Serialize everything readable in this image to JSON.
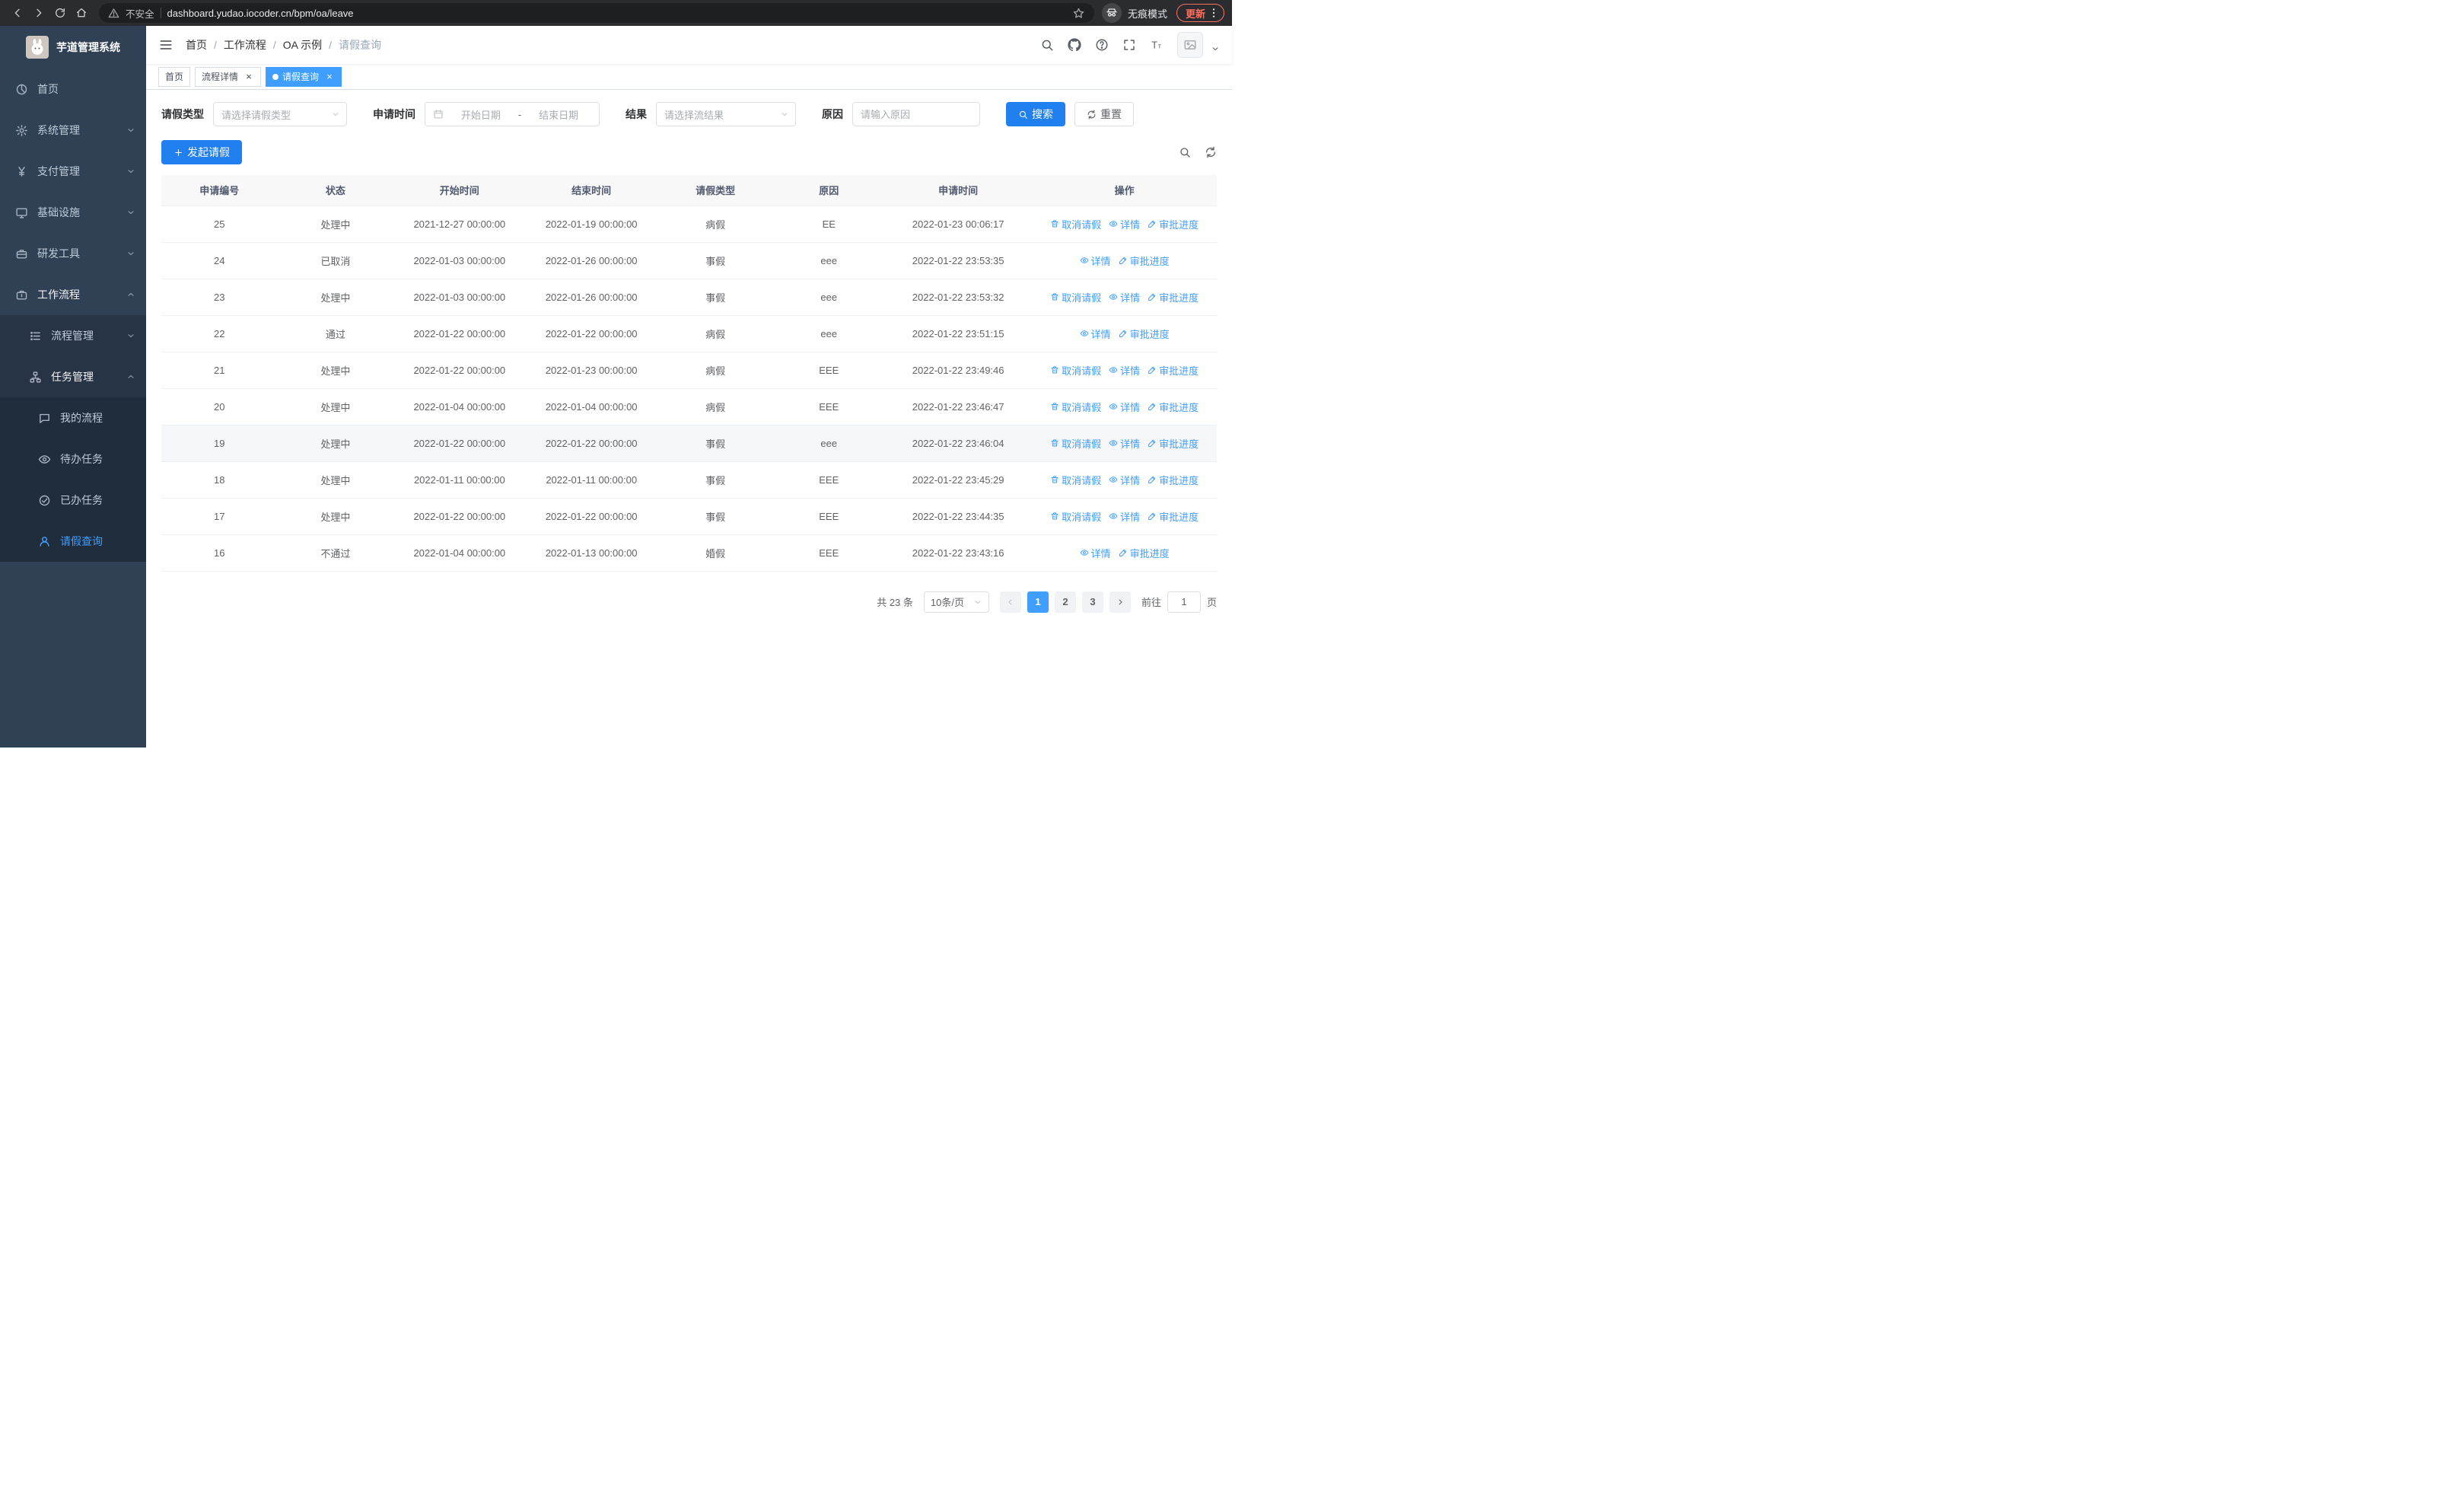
{
  "browser": {
    "security_warning": "不安全",
    "url": "dashboard.yudao.iocoder.cn/bpm/oa/leave",
    "incognito_label": "无痕模式",
    "update_button": "更新"
  },
  "sidebar": {
    "logo_title": "芋道管理系统",
    "items": [
      {
        "key": "home",
        "label": "首页",
        "icon": "dashboard",
        "level": 1
      },
      {
        "key": "system",
        "label": "系统管理",
        "icon": "gear",
        "level": 1,
        "arrow": "down"
      },
      {
        "key": "payment",
        "label": "支付管理",
        "icon": "yen",
        "level": 1,
        "arrow": "down"
      },
      {
        "key": "infrastructure",
        "label": "基础设施",
        "icon": "monitor",
        "level": 1,
        "arrow": "down"
      },
      {
        "key": "devtools",
        "label": "研发工具",
        "icon": "tools",
        "level": 1,
        "arrow": "down"
      },
      {
        "key": "workflow",
        "label": "工作流程",
        "icon": "work",
        "level": 1,
        "arrow": "up",
        "open": true
      },
      {
        "key": "process-mgmt",
        "label": "流程管理",
        "icon": "list",
        "level": 2,
        "arrow": "down"
      },
      {
        "key": "task-mgmt",
        "label": "任务管理",
        "icon": "tasks",
        "level": 2,
        "arrow": "up",
        "open": true
      },
      {
        "key": "my-process",
        "label": "我的流程",
        "icon": "chat",
        "level": 3
      },
      {
        "key": "todo-tasks",
        "label": "待办任务",
        "icon": "eye",
        "level": 3
      },
      {
        "key": "done-tasks",
        "label": "已办任务",
        "icon": "check",
        "level": 3
      },
      {
        "key": "leave-query",
        "label": "请假查询",
        "icon": "user",
        "level": 3,
        "active": true
      }
    ]
  },
  "header": {
    "breadcrumb": [
      "首页",
      "工作流程",
      "OA 示例",
      "请假查询"
    ],
    "icons": [
      {
        "key": "search",
        "icon": "search"
      },
      {
        "key": "github",
        "icon": "github"
      },
      {
        "key": "help",
        "icon": "help"
      },
      {
        "key": "fullscreen",
        "icon": "fullscreen"
      },
      {
        "key": "font-size",
        "icon": "fontsize"
      }
    ]
  },
  "tabs": [
    {
      "key": "home",
      "label": "首页",
      "closable": false,
      "active": false
    },
    {
      "key": "process-detail",
      "label": "流程详情",
      "closable": true,
      "active": false
    },
    {
      "key": "leave-query",
      "label": "请假查询",
      "closable": true,
      "active": true
    }
  ],
  "filters": {
    "leave_type": {
      "label": "请假类型",
      "placeholder": "请选择请假类型"
    },
    "apply_time": {
      "label": "申请时间",
      "start_placeholder": "开始日期",
      "separator": "-",
      "end_placeholder": "结束日期"
    },
    "result": {
      "label": "结果",
      "placeholder": "请选择流结果"
    },
    "reason": {
      "label": "原因",
      "placeholder": "请输入原因"
    },
    "search_button": "搜索",
    "reset_button": "重置"
  },
  "toolbar": {
    "create_button": "发起请假"
  },
  "table": {
    "columns": [
      "申请编号",
      "状态",
      "开始时间",
      "结束时间",
      "请假类型",
      "原因",
      "申请时间",
      "操作"
    ],
    "action_labels": {
      "cancel": "取消请假",
      "detail": "详情",
      "progress": "审批进度"
    },
    "rows": [
      {
        "id": "25",
        "status": "处理中",
        "start": "2021-12-27 00:00:00",
        "end": "2022-01-19 00:00:00",
        "type": "病假",
        "reason": "EE",
        "apply_time": "2022-01-23 00:06:17",
        "actions": [
          "cancel",
          "detail",
          "progress"
        ]
      },
      {
        "id": "24",
        "status": "已取消",
        "start": "2022-01-03 00:00:00",
        "end": "2022-01-26 00:00:00",
        "type": "事假",
        "reason": "eee",
        "apply_time": "2022-01-22 23:53:35",
        "actions": [
          "detail",
          "progress"
        ]
      },
      {
        "id": "23",
        "status": "处理中",
        "start": "2022-01-03 00:00:00",
        "end": "2022-01-26 00:00:00",
        "type": "事假",
        "reason": "eee",
        "apply_time": "2022-01-22 23:53:32",
        "actions": [
          "cancel",
          "detail",
          "progress"
        ]
      },
      {
        "id": "22",
        "status": "通过",
        "start": "2022-01-22 00:00:00",
        "end": "2022-01-22 00:00:00",
        "type": "病假",
        "reason": "eee",
        "apply_time": "2022-01-22 23:51:15",
        "actions": [
          "detail",
          "progress"
        ]
      },
      {
        "id": "21",
        "status": "处理中",
        "start": "2022-01-22 00:00:00",
        "end": "2022-01-23 00:00:00",
        "type": "病假",
        "reason": "EEE",
        "apply_time": "2022-01-22 23:49:46",
        "actions": [
          "cancel",
          "detail",
          "progress"
        ]
      },
      {
        "id": "20",
        "status": "处理中",
        "start": "2022-01-04 00:00:00",
        "end": "2022-01-04 00:00:00",
        "type": "病假",
        "reason": "EEE",
        "apply_time": "2022-01-22 23:46:47",
        "actions": [
          "cancel",
          "detail",
          "progress"
        ]
      },
      {
        "id": "19",
        "status": "处理中",
        "start": "2022-01-22 00:00:00",
        "end": "2022-01-22 00:00:00",
        "type": "事假",
        "reason": "eee",
        "apply_time": "2022-01-22 23:46:04",
        "actions": [
          "cancel",
          "detail",
          "progress"
        ],
        "highlighted": true
      },
      {
        "id": "18",
        "status": "处理中",
        "start": "2022-01-11 00:00:00",
        "end": "2022-01-11 00:00:00",
        "type": "事假",
        "reason": "EEE",
        "apply_time": "2022-01-22 23:45:29",
        "actions": [
          "cancel",
          "detail",
          "progress"
        ]
      },
      {
        "id": "17",
        "status": "处理中",
        "start": "2022-01-22 00:00:00",
        "end": "2022-01-22 00:00:00",
        "type": "事假",
        "reason": "EEE",
        "apply_time": "2022-01-22 23:44:35",
        "actions": [
          "cancel",
          "detail",
          "progress"
        ]
      },
      {
        "id": "16",
        "status": "不通过",
        "start": "2022-01-04 00:00:00",
        "end": "2022-01-13 00:00:00",
        "type": "婚假",
        "reason": "EEE",
        "apply_time": "2022-01-22 23:43:16",
        "actions": [
          "detail",
          "progress"
        ]
      }
    ]
  },
  "pagination": {
    "total_text": "共 23 条",
    "page_size": "10条/页",
    "pages": [
      "1",
      "2",
      "3"
    ],
    "active_page": "1",
    "goto_label": "前往",
    "goto_value": "1",
    "goto_suffix": "页"
  },
  "colors": {
    "accent": "#409EFF",
    "primary_button": "#2080F0",
    "sidebar_bg": "#304156",
    "sidebar_sub_bg": "#263445",
    "sidebar_sub2_bg": "#1F2D3D",
    "sidebar_text": "#BFCBD9",
    "chrome_bg": "#2B2C2F",
    "omnibox_bg": "#1E1F22",
    "update_color": "#FF7061",
    "table_header_bg": "#F8F8F9",
    "border": "#EBEEF5",
    "highlight_row": "#F5F7FA"
  }
}
